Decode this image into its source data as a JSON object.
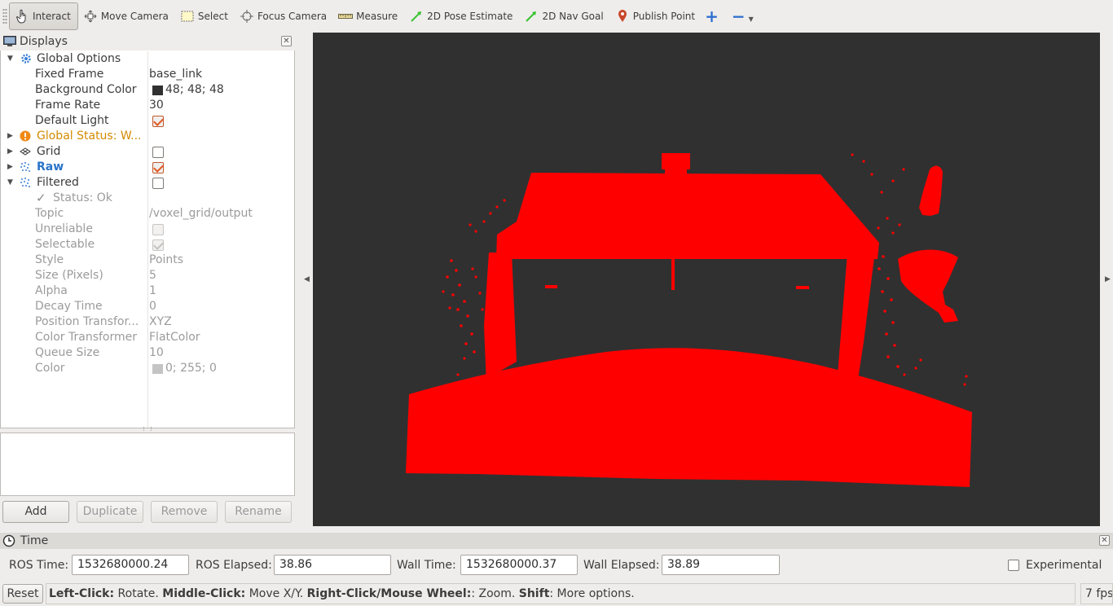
{
  "toolbar": {
    "tools": [
      {
        "label": "Interact",
        "icon": "hand-pointer-icon",
        "active": true
      },
      {
        "label": "Move Camera",
        "icon": "move-camera-icon"
      },
      {
        "label": "Select",
        "icon": "select-box-icon"
      },
      {
        "label": "Focus Camera",
        "icon": "crosshair-icon"
      },
      {
        "label": "Measure",
        "icon": "ruler-icon"
      },
      {
        "label": "2D Pose Estimate",
        "icon": "green-arrow-icon"
      },
      {
        "label": "2D Nav Goal",
        "icon": "green-arrow-icon"
      },
      {
        "label": "Publish Point",
        "icon": "map-pin-icon"
      }
    ],
    "add_symbol": "+",
    "remove_symbol": "−"
  },
  "displays": {
    "title": "Displays",
    "close_symbol": "✕",
    "rows": [
      {
        "label": "Global Options"
      },
      {
        "label": "Fixed Frame",
        "value": "base_link"
      },
      {
        "label": "Background Color",
        "value": "48; 48; 48",
        "swatch": "#303030"
      },
      {
        "label": "Frame Rate",
        "value": "30"
      },
      {
        "label": "Default Light"
      },
      {
        "label": "Global Status: W..."
      },
      {
        "label": "Grid"
      },
      {
        "label": "Raw"
      },
      {
        "label": "Filtered"
      },
      {
        "label": "Status: Ok"
      },
      {
        "label": "Topic",
        "value": "/voxel_grid/output"
      },
      {
        "label": "Unreliable"
      },
      {
        "label": "Selectable"
      },
      {
        "label": "Style",
        "value": "Points"
      },
      {
        "label": "Size (Pixels)",
        "value": "5"
      },
      {
        "label": "Alpha",
        "value": "1"
      },
      {
        "label": "Decay Time",
        "value": "0"
      },
      {
        "label": "Position Transfor...",
        "value": "XYZ"
      },
      {
        "label": "Color Transformer",
        "value": "FlatColor"
      },
      {
        "label": "Queue Size",
        "value": "10"
      },
      {
        "label": "Color",
        "value": "0; 255; 0",
        "swatch": "#c4c4c4"
      }
    ],
    "buttons": {
      "add": "Add",
      "duplicate": "Duplicate",
      "remove": "Remove",
      "rename": "Rename"
    }
  },
  "viewport": {
    "background": "#303030",
    "point_color": "#ff0000",
    "left_arrow": "◀",
    "right_arrow": "▶"
  },
  "time": {
    "title": "Time",
    "close_symbol": "✕",
    "ros_time_label": "ROS Time:",
    "ros_time": "1532680000.24",
    "ros_elapsed_label": "ROS Elapsed:",
    "ros_elapsed": "38.86",
    "wall_time_label": "Wall Time:",
    "wall_time": "1532680000.37",
    "wall_elapsed_label": "Wall Elapsed:",
    "wall_elapsed": "38.89",
    "experimental_label": "Experimental"
  },
  "status": {
    "reset": "Reset",
    "left_click_label": "Left-Click:",
    "left_click_text": " Rotate. ",
    "middle_click_label": "Middle-Click:",
    "middle_click_text": " Move X/Y. ",
    "right_click_label": "Right-Click/Mouse Wheel:",
    "right_click_text": ": Zoom. ",
    "shift_label": "Shift",
    "shift_text": ": More options.",
    "fps": "7 fps"
  }
}
